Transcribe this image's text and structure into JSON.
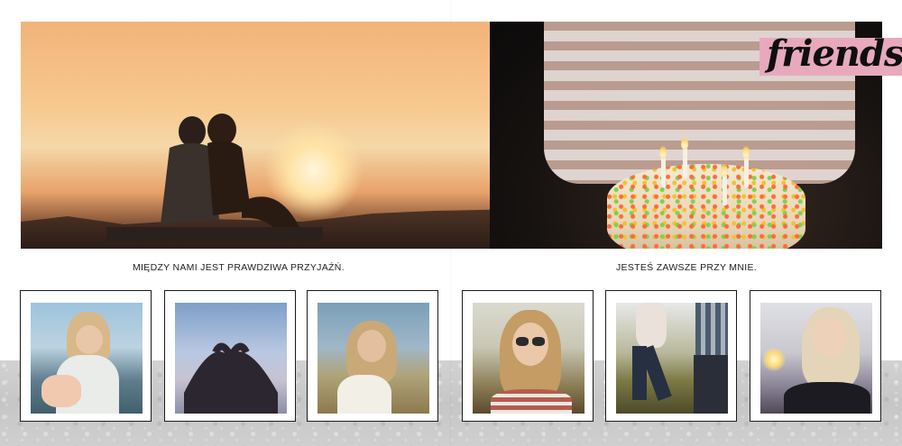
{
  "left_page": {
    "caption": "MIĘDZY NAMI JEST PRAWDZIWA PRZYJAŹŃ."
  },
  "right_page": {
    "banner_text": "friends",
    "caption": "JESTEŚ ZAWSZE PRZY MNIE."
  },
  "colors": {
    "banner_pink": "#e8a9bd",
    "frame_border": "#1b1b1b",
    "concrete_gray": "#cccccc"
  }
}
